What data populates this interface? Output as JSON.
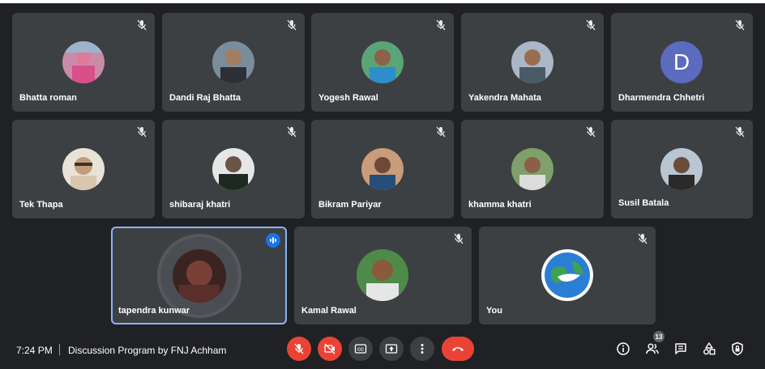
{
  "participants": [
    {
      "name": "Bhatta roman"
    },
    {
      "name": "Dandi Raj Bhatta"
    },
    {
      "name": "Yogesh Rawal"
    },
    {
      "name": "Yakendra Mahata"
    },
    {
      "name": "Dharmendra Chhetri",
      "initial": "D"
    },
    {
      "name": "Tek Thapa"
    },
    {
      "name": "shibaraj khatri"
    },
    {
      "name": "Bikram Pariyar"
    },
    {
      "name": "khamma khatri"
    },
    {
      "name": "Susil Batala"
    },
    {
      "name": "tapendra kunwar"
    },
    {
      "name": "Kamal Rawal"
    },
    {
      "name": "You"
    }
  ],
  "bottom_bar": {
    "time": "7:24 PM",
    "meeting_title": "Discussion Program by FNJ Achham",
    "participant_count": "13"
  },
  "colors": {
    "background": "#202124",
    "tile": "#3c4043",
    "end_call": "#ea4335",
    "speaking_border": "#8ab4f8",
    "avatar_letter_bg": "#5c6bc0"
  }
}
